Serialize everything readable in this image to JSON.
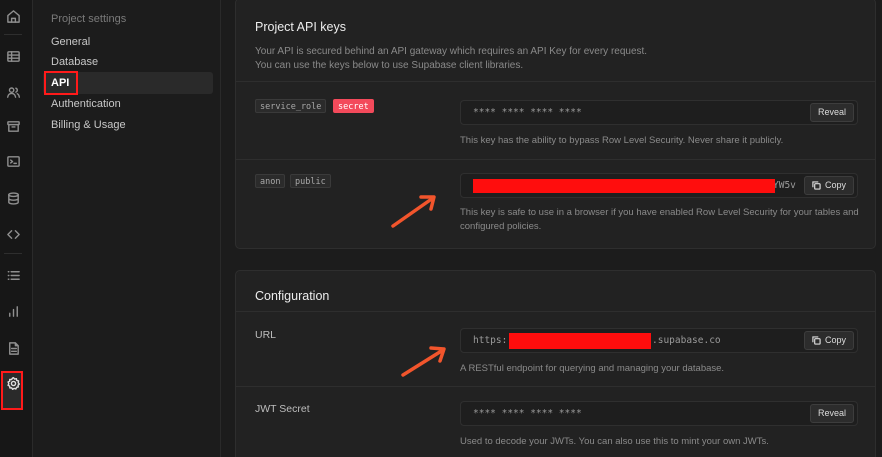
{
  "rail": {
    "icons": [
      "home-icon",
      "table-icon",
      "users-icon",
      "archive-icon",
      "terminal-icon",
      "database-icon",
      "code-icon",
      "list-icon",
      "chart-icon",
      "document-icon",
      "gear-icon"
    ]
  },
  "menu": {
    "heading": "Project settings",
    "items": [
      "General",
      "Database",
      "API",
      "Authentication",
      "Billing & Usage"
    ],
    "active": "API"
  },
  "api_keys": {
    "title": "Project API keys",
    "description_line1": "Your API is secured behind an API gateway which requires an API Key for every request.",
    "description_line2": "You can use the keys below to use Supabase client libraries.",
    "service_role": {
      "tag": "service_role",
      "badge": "secret",
      "value": "**** **** **** ****",
      "button": "Reveal",
      "hint": "This key has the ability to bypass Row Level Security. Never share it publicly."
    },
    "anon": {
      "tag1": "anon",
      "tag2": "public",
      "value_suffix": "YW5v",
      "button": "Copy",
      "hint": "This key is safe to use in a browser if you have enabled Row Level Security for your tables and configured policies."
    }
  },
  "configuration": {
    "title": "Configuration",
    "url": {
      "label": "URL",
      "prefix": "https:",
      "suffix": ".supabase.co",
      "button": "Copy",
      "hint": "A RESTful endpoint for querying and managing your database."
    },
    "jwt": {
      "label": "JWT Secret",
      "value": "**** **** **** ****",
      "button": "Reveal",
      "hint": "Used to decode your JWTs. You can also use this to mint your own JWTs."
    }
  },
  "colors": {
    "background": "#1c1c1c",
    "card": "#222222",
    "secret_badge": "#f34a5b",
    "annotation_red": "#ff1a1a",
    "arrow_orange": "#f2552c"
  }
}
